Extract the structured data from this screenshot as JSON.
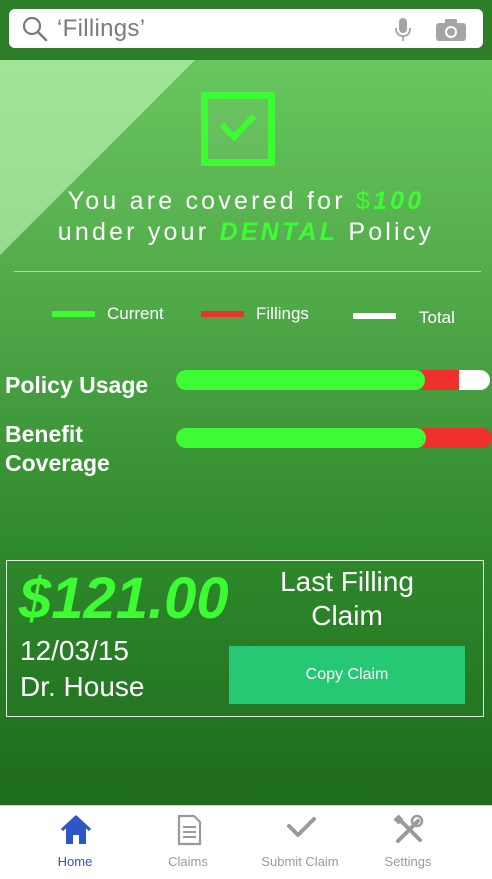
{
  "search": {
    "query": "‘Fillings’",
    "icons": [
      "search-icon",
      "microphone-icon",
      "camera-icon"
    ]
  },
  "coverage": {
    "line1_prefix": "You are covered for ",
    "currency": "$",
    "amount": "100",
    "line2_prefix": "under your ",
    "policy": "DENTAL",
    "line2_suffix": " Policy"
  },
  "legend": [
    {
      "label": "Current",
      "color": "#3efc34"
    },
    {
      "label": "Fillings",
      "color": "#f0302c"
    },
    {
      "label": "Total",
      "color": "#ffffff"
    }
  ],
  "usage_rows": [
    {
      "label": "Policy Usage",
      "current_fraction": 0.78,
      "fillings_fraction": 0.12,
      "total_fraction": 0.1
    },
    {
      "label": "Benefit Coverage",
      "current_fraction": 0.78,
      "fillings_fraction": 0.22,
      "total_fraction": 0.0
    }
  ],
  "claim": {
    "amount": "$121.00",
    "date": "12/03/15",
    "doctor": "Dr. House",
    "title": "Last Filling Claim",
    "button": "Copy Claim"
  },
  "tabs": [
    {
      "label": "Home",
      "icon": "home-icon",
      "active": true
    },
    {
      "label": "Claims",
      "icon": "document-icon",
      "active": false
    },
    {
      "label": "Submit Claim",
      "icon": "checkmark-icon",
      "active": false
    },
    {
      "label": "Settings",
      "icon": "tools-icon",
      "active": false
    }
  ],
  "colors": {
    "accent_green": "#3efc34",
    "fillings_red": "#f0302c",
    "button_green": "#26c874",
    "active_tab_blue": "#2c56c6"
  }
}
